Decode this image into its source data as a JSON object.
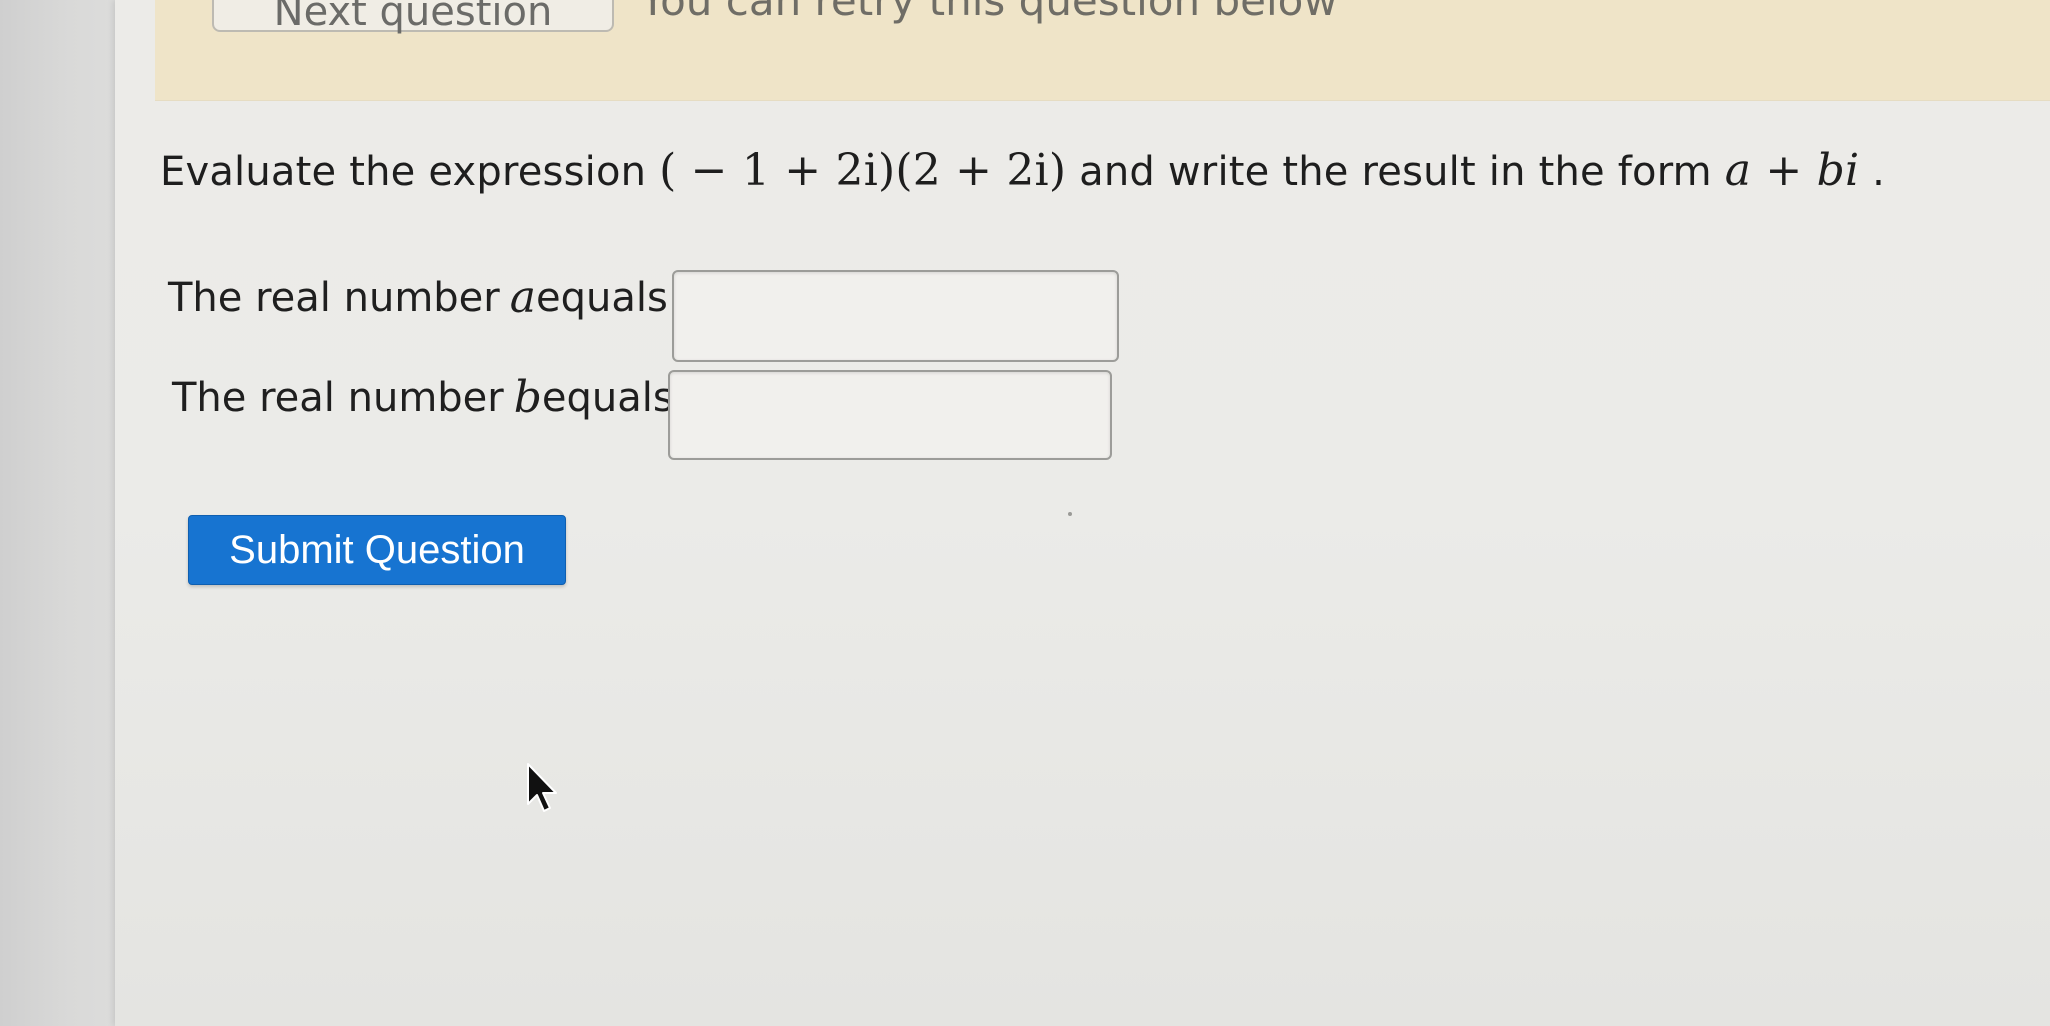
{
  "banner": {
    "next_button_label": "Next question",
    "retry_message": "You can retry this question below"
  },
  "question": {
    "prompt_prefix": "Evaluate the expression ",
    "expression": "( − 1 + 2i)(2 + 2i)",
    "prompt_middle": " and write the result in the form ",
    "form": "a + bi",
    "prompt_suffix": "."
  },
  "answers": {
    "a": {
      "label_prefix": "The real number ",
      "variable": "a",
      "label_suffix": " equals",
      "value": ""
    },
    "b": {
      "label_prefix": "The real number ",
      "variable": "b",
      "label_suffix": " equals",
      "value": ""
    }
  },
  "submit": {
    "label": "Submit Question"
  },
  "colors": {
    "submit_blue": "#1774d1",
    "banner": "#efe4c8",
    "background": "#ecebe8"
  },
  "icons": {
    "cursor": "mouse-pointer-icon"
  }
}
